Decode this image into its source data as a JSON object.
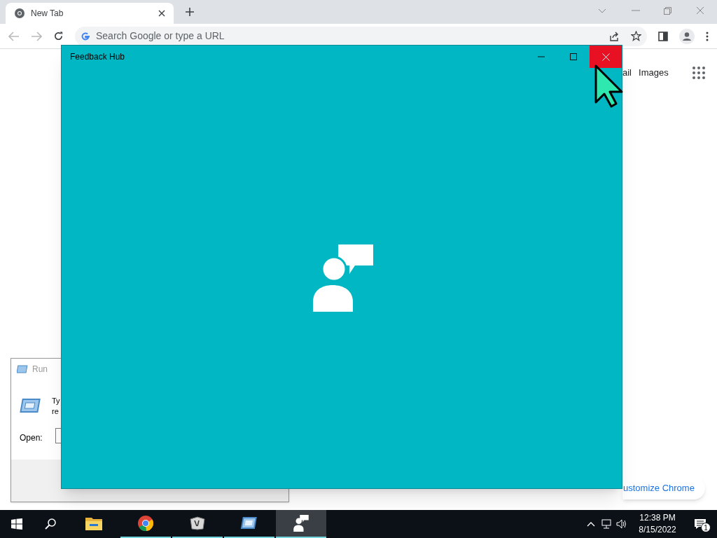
{
  "browser": {
    "tab": {
      "title": "New Tab"
    },
    "address": {
      "placeholder": "Search Google or type a URL"
    },
    "top_links": [
      "ail",
      "Images"
    ],
    "customize": "ustomize Chrome"
  },
  "run_dialog": {
    "title": "Run",
    "text_lines": [
      "Ty",
      "re"
    ],
    "open_label": "Open:"
  },
  "feedback_window": {
    "title": "Feedback Hub",
    "close_hovered": true
  },
  "taskbar": {
    "apps": [
      {
        "kind": "folder",
        "running": false,
        "selected": false
      },
      {
        "kind": "chrome",
        "running": true,
        "selected": false
      },
      {
        "kind": "script",
        "running": true,
        "selected": false
      },
      {
        "kind": "run",
        "running": true,
        "selected": false
      },
      {
        "kind": "feedback",
        "running": true,
        "selected": true
      }
    ],
    "time": "12:38 PM",
    "date": "8/15/2022",
    "notifications": "1"
  }
}
